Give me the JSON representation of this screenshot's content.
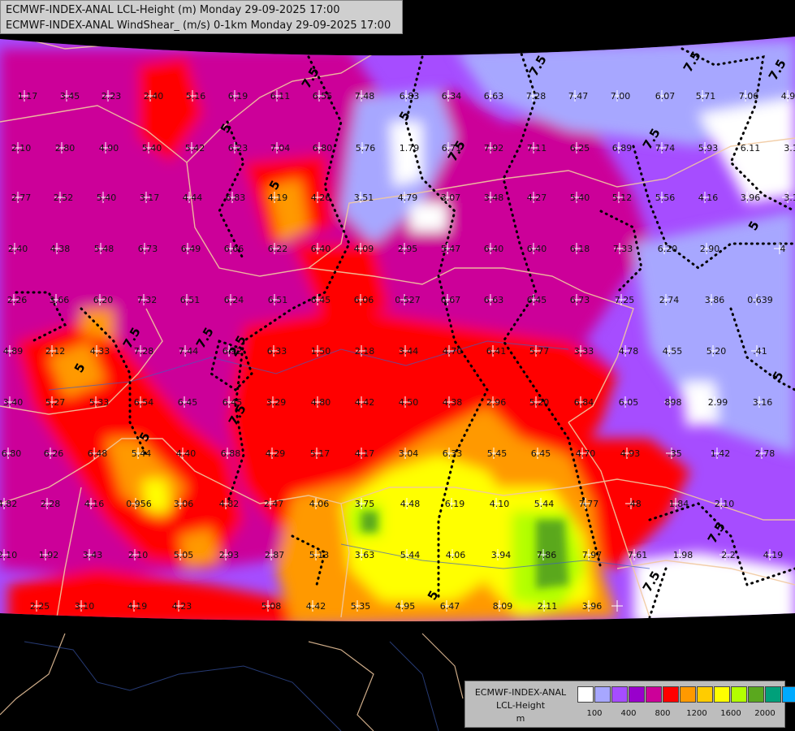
{
  "title": {
    "line1": "ECMWF-INDEX-ANAL LCL-Height (m) Monday 29-09-2025 17:00",
    "line2": "ECMWF-INDEX-ANAL WindShear_ (m/s) 0-1km Monday 29-09-2025 17:00"
  },
  "legend": {
    "line1": "ECMWF-INDEX-ANAL",
    "line2": "LCL-Height",
    "line3": "m",
    "colors": [
      "#ffffff",
      "#a7a7ff",
      "#a64dff",
      "#9900cc",
      "#cc0099",
      "#ff0000",
      "#ff9900",
      "#ffcc00",
      "#ffff00",
      "#b3ff00",
      "#5aa81e",
      "#00a07a",
      "#00aaff"
    ],
    "ticks": [
      "100",
      "400",
      "800",
      "1200",
      "1600",
      "2000"
    ]
  },
  "contour_labels": [
    "7.5",
    "5",
    "2.5"
  ],
  "station_values": [
    "1.17",
    "3.45",
    "2.23",
    "2.40",
    "5.16",
    "6.19",
    "6.11",
    "6.55",
    "7.48",
    "6.83",
    "6.34",
    "6.63",
    "7.28",
    "7.47",
    "7.00",
    "6.07",
    "5.71",
    "7.06",
    "4.94",
    "2.10",
    "2.80",
    "4.90",
    "5.40",
    "5.42",
    "6.23",
    "7.04",
    "6.80",
    "5.76",
    "1.79",
    "6.71",
    "7.92",
    "7.11",
    "6.25",
    "6.89",
    "7.74",
    "5.93",
    "6.11",
    "3.1",
    "2.77",
    "2.52",
    "5.40",
    "3.17",
    "4.44",
    "6.83",
    "4.19",
    "4.26",
    "3.51",
    "4.79",
    "3.07",
    "3.48",
    "4.27",
    "5.40",
    "5.12",
    "5.56",
    "4.16",
    "3.96",
    "3.1",
    "2.40",
    "4.38",
    "5.48",
    "6.73",
    "6.49",
    "6.66",
    "6.22",
    "6.40",
    "4.09",
    "2.95",
    "5.47",
    "6.40",
    "6.40",
    "6.18",
    "7.33",
    "6.20",
    "2.90",
    "4",
    "2.26",
    "3.66",
    "6.20",
    "7.32",
    "6.51",
    "6.24",
    "6.51",
    "6.45",
    "6.06",
    "0.527",
    "6.67",
    "6.63",
    "6.45",
    "6.73",
    "7.25",
    "2.74",
    "3.86",
    "0.639",
    "4.89",
    "2.12",
    "4.33",
    "7.28",
    "7.44",
    "6.92",
    "6.33",
    "1.50",
    "2.18",
    "3.44",
    "4.70",
    "6.41",
    "5.77",
    "3.33",
    "4.78",
    "4.55",
    "5.20",
    ".41",
    "3.40",
    "5.27",
    "5.33",
    "6.54",
    "6.45",
    "6.45",
    "3.29",
    "4.80",
    "4.42",
    "4.50",
    "4.38",
    "2.96",
    "5.20",
    "6.84",
    "6.05",
    "898",
    "2.99",
    "3.16",
    "6.80",
    "6.26",
    "6.48",
    "5.44",
    "4.40",
    "6.88",
    "4.29",
    "5.17",
    "4.17",
    "3.04",
    "6.33",
    "5.45",
    "6.45",
    "4.70",
    "4.93",
    ".35",
    "1.42",
    "2.78",
    "4.82",
    "2.28",
    "4.16",
    "0.956",
    "3.06",
    "4.82",
    "2.47",
    "4.06",
    "3.75",
    "4.48",
    "6.19",
    "4.10",
    "5.44",
    "7.77",
    ".48",
    "1.84",
    "2.10",
    "2.10",
    "1.92",
    "3.43",
    "2.10",
    "5.05",
    "2.93",
    "2.87",
    "5.13",
    "3.63",
    "5.44",
    "4.06",
    "3.94",
    "7.86",
    "7.97",
    "7.61",
    "1.98",
    "2.2",
    "4.19",
    "2.25",
    "3.10",
    "4.19",
    "4.23",
    "5.08",
    "4.42",
    "5.35",
    "4.95",
    "6.47",
    "8.09",
    "2.11",
    "3.96"
  ]
}
